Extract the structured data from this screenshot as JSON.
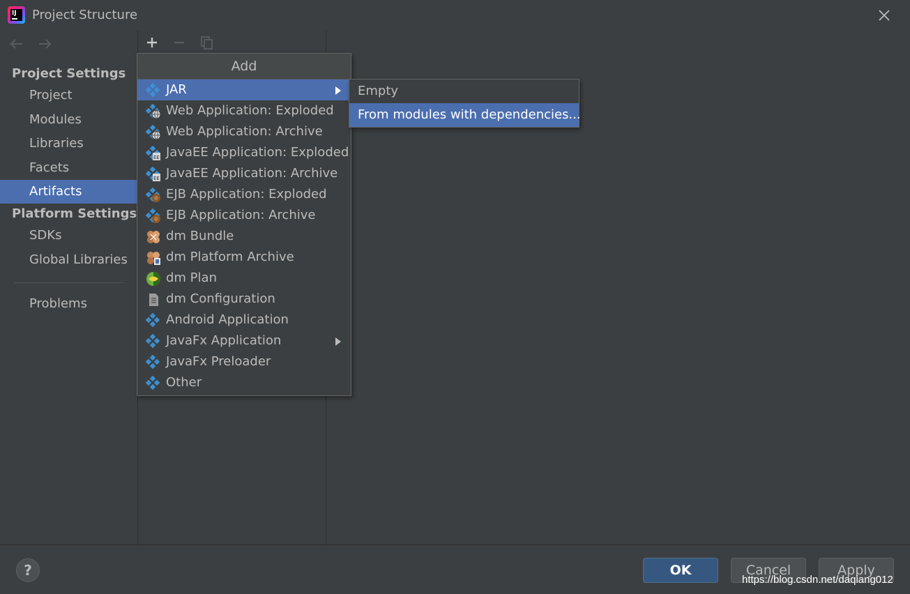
{
  "window": {
    "title": "Project Structure",
    "app_icon_text": "IJ"
  },
  "sidebar": {
    "project_settings_header": "Project Settings",
    "project_items": [
      {
        "label": "Project"
      },
      {
        "label": "Modules"
      },
      {
        "label": "Libraries"
      },
      {
        "label": "Facets"
      },
      {
        "label": "Artifacts",
        "selected": true
      }
    ],
    "platform_settings_header": "Platform Settings",
    "platform_items": [
      {
        "label": "SDKs"
      },
      {
        "label": "Global Libraries"
      }
    ],
    "problems_label": "Problems"
  },
  "add_menu": {
    "header": "Add",
    "items": [
      {
        "label": "JAR",
        "icon": "artifact-icon",
        "has_submenu": true,
        "active": true
      },
      {
        "label": "Web Application: Exploded",
        "icon": "web-artifact-icon"
      },
      {
        "label": "Web Application: Archive",
        "icon": "web-artifact-icon"
      },
      {
        "label": "JavaEE Application: Exploded",
        "icon": "javaee-artifact-icon"
      },
      {
        "label": "JavaEE Application: Archive",
        "icon": "javaee-artifact-icon"
      },
      {
        "label": "EJB Application: Exploded",
        "icon": "ejb-artifact-icon"
      },
      {
        "label": "EJB Application: Archive",
        "icon": "ejb-artifact-icon"
      },
      {
        "label": "dm Bundle",
        "icon": "dm-bundle-icon"
      },
      {
        "label": "dm Platform Archive",
        "icon": "dm-platform-icon"
      },
      {
        "label": "dm Plan",
        "icon": "dm-plan-icon"
      },
      {
        "label": "dm Configuration",
        "icon": "dm-configuration-icon"
      },
      {
        "label": "Android Application",
        "icon": "artifact-icon"
      },
      {
        "label": "JavaFx Application",
        "icon": "artifact-icon",
        "has_submenu": true
      },
      {
        "label": "JavaFx Preloader",
        "icon": "artifact-icon"
      },
      {
        "label": "Other",
        "icon": "artifact-icon"
      }
    ]
  },
  "jar_submenu": {
    "items": [
      {
        "label": "Empty"
      },
      {
        "label": "From modules with dependencies...",
        "active": true
      }
    ]
  },
  "footer": {
    "help_label": "?",
    "ok_label": "OK",
    "cancel_label": "Cancel",
    "apply_label": "Apply",
    "watermark": "https://blog.csdn.net/daqiang012"
  },
  "colors": {
    "background": "#3c3f41",
    "selection": "#4b6eaf",
    "text": "#bbbbbb",
    "artifact_blue": "#3d8fd1"
  }
}
